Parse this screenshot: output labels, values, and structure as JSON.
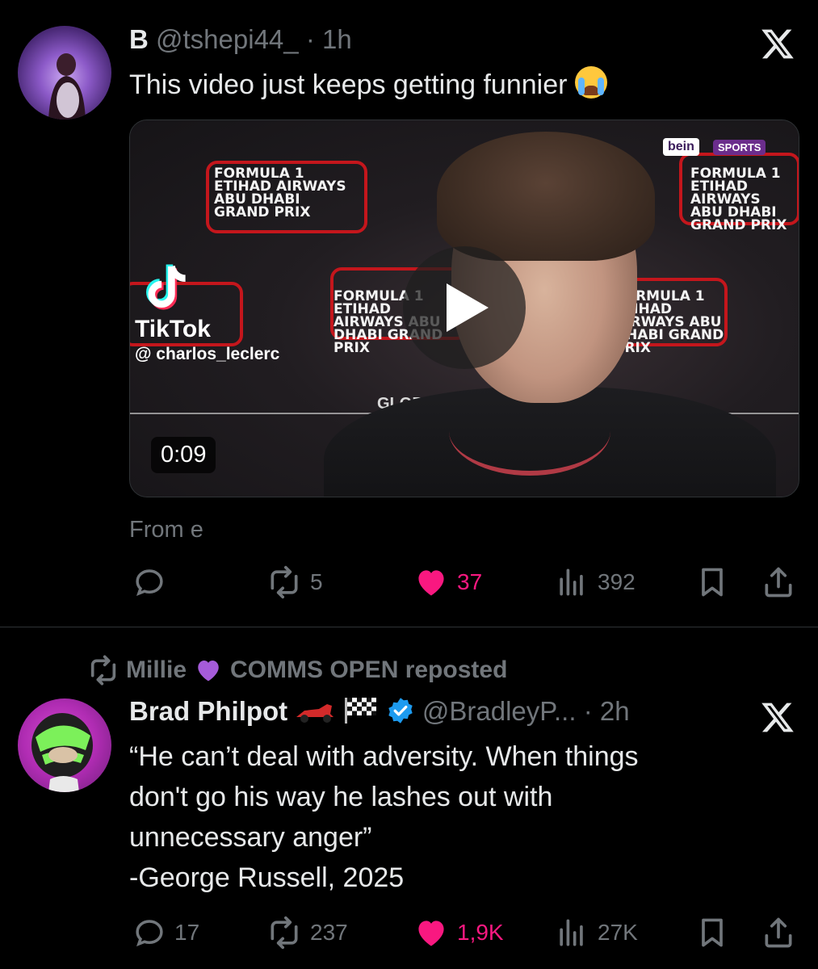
{
  "tweet1": {
    "name": "B",
    "handle": "@tshepi44_",
    "time": "· 1h",
    "text": "This video just keeps getting funnier",
    "media": {
      "duration": "0:09",
      "watermark_brand": "TikTok",
      "watermark_user": "@ charlos_leclerc",
      "broadcaster": "bein",
      "broadcaster_sub": "SPORTS",
      "board_text": "FORMULA 1 ETIHAD AIRWAYS ABU DHABI GRAND PRIX",
      "board_small": "ETIHAD",
      "global": "GLOBA"
    },
    "from": "From e",
    "stats": {
      "replies": "",
      "reposts": "5",
      "likes": "37",
      "views": "392"
    }
  },
  "reposted_by": {
    "name": "Millie",
    "suffix": "COMMS OPEN reposted"
  },
  "tweet2": {
    "name": "Brad Philpot",
    "handle": "@BradleyP...",
    "time": "· 2h",
    "text_lines": [
      "“He can’t deal with adversity. When things",
      "don't go his way he lashes out with",
      "unnecessary anger”",
      "-George Russell, 2025"
    ],
    "stats": {
      "replies": "17",
      "reposts": "237",
      "likes": "1,9K",
      "views": "27K"
    }
  },
  "colors": {
    "background": "#000000",
    "text": "#e7e9ea",
    "muted": "#71767b",
    "like": "#f91880",
    "verified": "#1d9bf0",
    "divider": "#2f3336"
  },
  "icons": [
    "x-logo-icon",
    "reply-icon",
    "repost-icon",
    "heart-icon",
    "views-icon",
    "bookmark-icon",
    "share-icon",
    "play-icon",
    "verified-icon",
    "purple-heart-icon",
    "race-car-icon",
    "checkered-flag-icon",
    "crying-face-icon"
  ]
}
